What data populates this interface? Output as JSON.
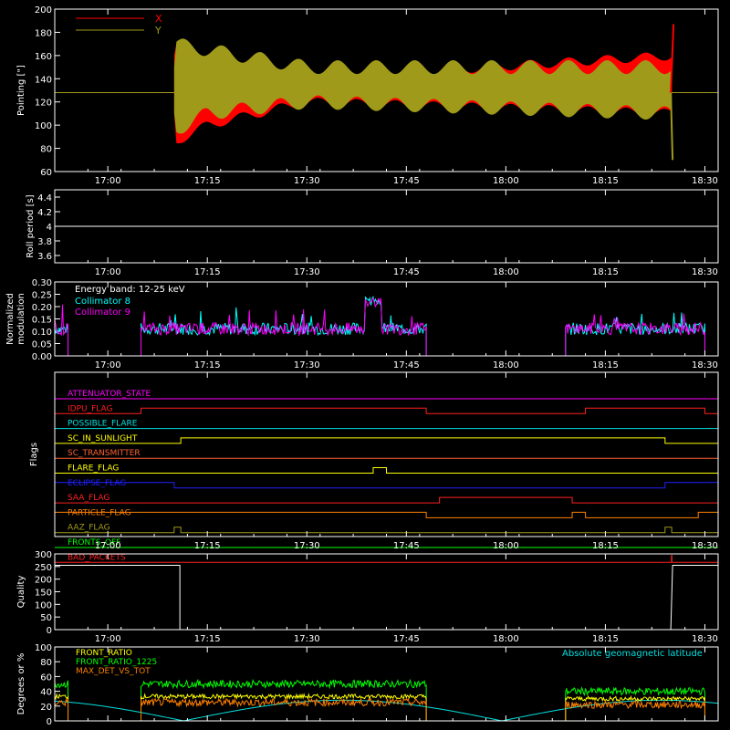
{
  "chart_data": [
    {
      "id": "pointing",
      "type": "line",
      "ylabel": "Pointing [\"]",
      "ylim": [
        60,
        200
      ],
      "yticks": [
        60,
        80,
        100,
        120,
        140,
        160,
        180,
        200
      ],
      "xticks": [
        "17:00",
        "17:15",
        "17:30",
        "17:45",
        "18:00",
        "18:15",
        "18:30"
      ],
      "xrange": [
        "16:52",
        "18:32"
      ],
      "series": [
        {
          "name": "X",
          "color": "#ff0000",
          "baseline": 128,
          "active_start": "17:10",
          "active_end": "18:25",
          "envelope_upper": [
            [
              17.167,
              170
            ],
            [
              17.25,
              150
            ],
            [
              17.5,
              140
            ],
            [
              18.417,
              160
            ]
          ],
          "envelope_lower": [
            [
              17.167,
              85
            ],
            [
              17.25,
              100
            ],
            [
              17.5,
              120
            ],
            [
              18.417,
              110
            ]
          ]
        },
        {
          "name": "Y",
          "color": "#a09a1a",
          "baseline": 128,
          "active_start": "17:10",
          "active_end": "18:25",
          "envelope_upper": [
            [
              17.167,
              170
            ],
            [
              17.25,
              165
            ],
            [
              17.5,
              150
            ],
            [
              18.417,
              150
            ]
          ],
          "envelope_lower": [
            [
              17.167,
              95
            ],
            [
              17.25,
              110
            ],
            [
              17.5,
              120
            ],
            [
              18.417,
              110
            ]
          ]
        }
      ]
    },
    {
      "id": "roll",
      "type": "line",
      "ylabel": "Roll period [s]",
      "ylim": [
        3.5,
        4.5
      ],
      "yticks": [
        3.6,
        3.8,
        4.0,
        4.2,
        4.4
      ],
      "xticks": [
        "17:00",
        "17:15",
        "17:30",
        "17:45",
        "18:00",
        "18:15",
        "18:30"
      ],
      "series": [
        {
          "name": "",
          "color": "#ffffff",
          "value": 4.0
        }
      ]
    },
    {
      "id": "modulation",
      "type": "line",
      "ylabel": "Normalized modulation",
      "ylim": [
        0.0,
        0.3
      ],
      "yticks": [
        "0.00",
        "0.05",
        "0.10",
        "0.15",
        "0.20",
        "0.25",
        "0.30"
      ],
      "xticks": [
        "17:00",
        "17:15",
        "17:30",
        "17:45",
        "18:00",
        "18:15",
        "18:30"
      ],
      "annotation": "Energy band: 12-25 keV",
      "series": [
        {
          "name": "Collimator 8",
          "color": "#00ffff",
          "level": 0.11,
          "segments": [
            [
              "16:52",
              "16:54"
            ],
            [
              "17:05",
              "17:48"
            ],
            [
              "18:09",
              "18:30"
            ]
          ]
        },
        {
          "name": "Collimator 9",
          "color": "#ff00ff",
          "level": 0.11,
          "segments": [
            [
              "16:52",
              "16:54"
            ],
            [
              "17:05",
              "17:48"
            ],
            [
              "18:09",
              "18:30"
            ]
          ]
        }
      ],
      "spike": {
        "time": "17:40",
        "value": 0.24
      }
    },
    {
      "id": "flags",
      "type": "line",
      "ylabel": "Flags",
      "xticks": [
        "17:00",
        "17:15",
        "17:30",
        "17:45",
        "18:00",
        "18:15",
        "18:30"
      ],
      "flags": [
        {
          "name": "ATTENUATOR_STATE",
          "color": "#ff00ff",
          "steps": []
        },
        {
          "name": "IDPU_FLAG",
          "color": "#ff2020",
          "steps": [
            [
              "17:05",
              "up"
            ],
            [
              "17:48",
              "down"
            ],
            [
              "18:12",
              "up"
            ],
            [
              "18:30",
              "down"
            ]
          ]
        },
        {
          "name": "POSSIBLE_FLARE",
          "color": "#00e0e0",
          "steps": []
        },
        {
          "name": "SC_IN_SUNLIGHT",
          "color": "#ffff00",
          "steps": [
            [
              "17:11",
              "up"
            ],
            [
              "18:24",
              "down"
            ]
          ]
        },
        {
          "name": "SC_TRANSMITTER",
          "color": "#ff6030",
          "steps": []
        },
        {
          "name": "FLARE_FLAG",
          "color": "#ffff00",
          "steps": [
            [
              "17:40",
              "up"
            ],
            [
              "17:42",
              "down"
            ]
          ]
        },
        {
          "name": "ECLIPSE_FLAG",
          "color": "#2020ff",
          "steps": [
            [
              "17:10",
              "down"
            ],
            [
              "18:24",
              "up"
            ]
          ]
        },
        {
          "name": "SAA_FLAG",
          "color": "#ff2020",
          "steps": [
            [
              "17:50",
              "up"
            ],
            [
              "18:10",
              "down"
            ]
          ]
        },
        {
          "name": "PARTICLE_FLAG",
          "color": "#ff8000",
          "steps": [
            [
              "17:48",
              "down"
            ],
            [
              "18:10",
              "up"
            ],
            [
              "18:12",
              "down"
            ],
            [
              "18:29",
              "up"
            ]
          ]
        },
        {
          "name": "AAZ_FLAG",
          "color": "#a09a1a",
          "steps": [
            [
              "17:10",
              "up"
            ],
            [
              "17:11",
              "down"
            ],
            [
              "18:24",
              "up"
            ],
            [
              "18:25",
              "down"
            ]
          ]
        },
        {
          "name": "FRONTS_OFF",
          "color": "#00ff00",
          "steps": []
        },
        {
          "name": "BAD_PACKETS",
          "color": "#ff2020",
          "steps": [
            [
              "18:25",
              "spike"
            ]
          ]
        }
      ]
    },
    {
      "id": "quality",
      "type": "line",
      "ylabel": "Quality",
      "ylim": [
        0,
        300
      ],
      "yticks": [
        0,
        50,
        100,
        150,
        200,
        250,
        300
      ],
      "xticks": [
        "17:00",
        "17:15",
        "17:30",
        "17:45",
        "18:00",
        "18:15",
        "18:30"
      ],
      "series": [
        {
          "name": "",
          "color": "#ffffff",
          "high": 255,
          "low": 0,
          "low_start": "17:11",
          "low_end": "18:25"
        }
      ]
    },
    {
      "id": "ratios",
      "type": "line",
      "ylabel": "Degrees or %",
      "ylim": [
        0,
        100
      ],
      "yticks": [
        0,
        20,
        40,
        60,
        80,
        100
      ],
      "xticks": [
        "17:00",
        "17:15",
        "17:30",
        "17:45",
        "18:00",
        "18:15",
        "18:30"
      ],
      "annotation": "Absolute geomagnetic latitude",
      "series": [
        {
          "name": "FRONT_RATIO",
          "color": "#ffff00",
          "level": 33
        },
        {
          "name": "FRONT_RATIO_1225",
          "color": "#00ff00",
          "level": 50
        },
        {
          "name": "MAX_DET_VS_TOT",
          "color": "#ff8000",
          "level": 25
        },
        {
          "name": "Absolute geomagnetic latitude",
          "color": "#00e0e0"
        }
      ]
    }
  ]
}
